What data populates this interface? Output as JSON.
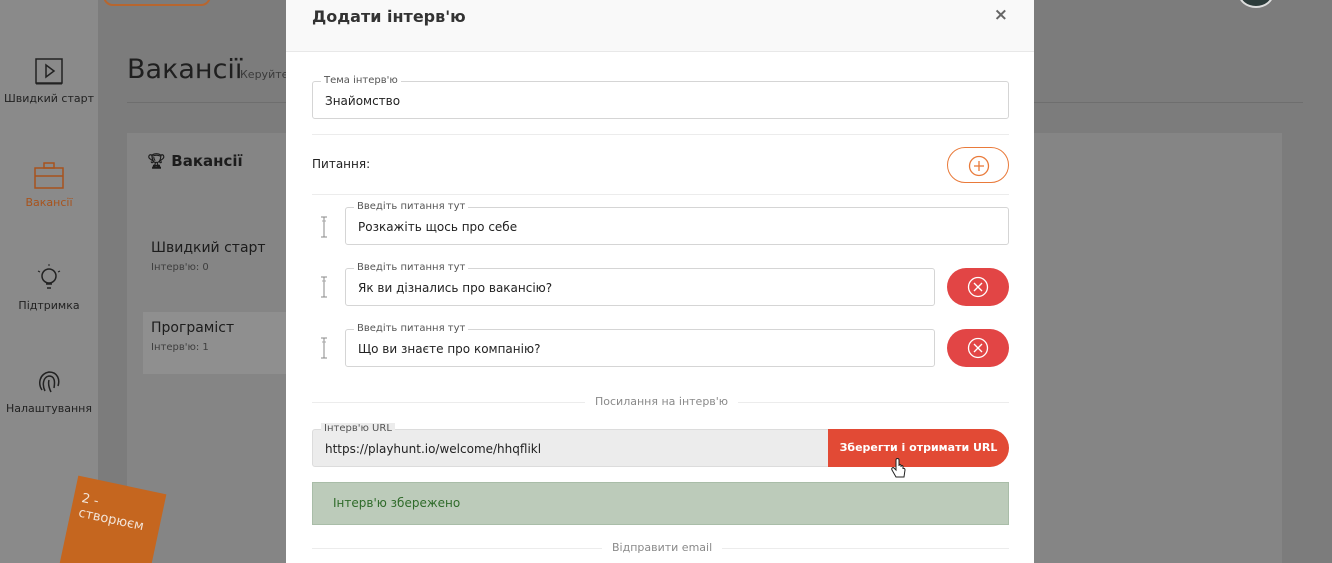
{
  "sidebar": {
    "items": [
      {
        "label": "Швидкий старт",
        "icon": "play-icon"
      },
      {
        "label": "Вакансії",
        "icon": "briefcase-icon",
        "active": true
      },
      {
        "label": "Підтримка",
        "icon": "lightbulb-icon"
      },
      {
        "label": "Налаштування",
        "icon": "fingerprint-icon"
      }
    ]
  },
  "background": {
    "page_title": "Вакансії",
    "page_subtitle": "Керуйте",
    "panel_title": "Вакансії",
    "cards": [
      {
        "title": "Швидкий старт",
        "sub": "Інтерв'ю: 0"
      },
      {
        "title": "Програміст",
        "sub": "Інтерв'ю: 1"
      }
    ],
    "badge_text": "2 - створюєм"
  },
  "modal": {
    "title": "Додати інтерв'ю",
    "close": "×",
    "topic": {
      "legend": "Тема інтерв'ю",
      "value": "Знайомство"
    },
    "questions_label": "Питання:",
    "questions": [
      {
        "legend": "Введіть питання тут",
        "value": "Розкажіть щось про себе",
        "deletable": false
      },
      {
        "legend": "Введіть питання тут",
        "value": "Як ви дізнались про вакансію?",
        "deletable": true
      },
      {
        "legend": "Введіть питання тут",
        "value": "Що ви знаєте про компанію?",
        "deletable": true
      }
    ],
    "link_divider": "Посилання на інтерв'ю",
    "url": {
      "legend": "Інтерв'ю URL",
      "value": "https://playhunt.io/welcome/hhqflikl"
    },
    "save_button": "Зберегти і отримати URL",
    "success_message": "Інтерв'ю збережено",
    "email_divider": "Відправити email"
  },
  "colors": {
    "accent": "#e24545",
    "orange": "#e97a3a",
    "success_bg": "#bccbba"
  }
}
